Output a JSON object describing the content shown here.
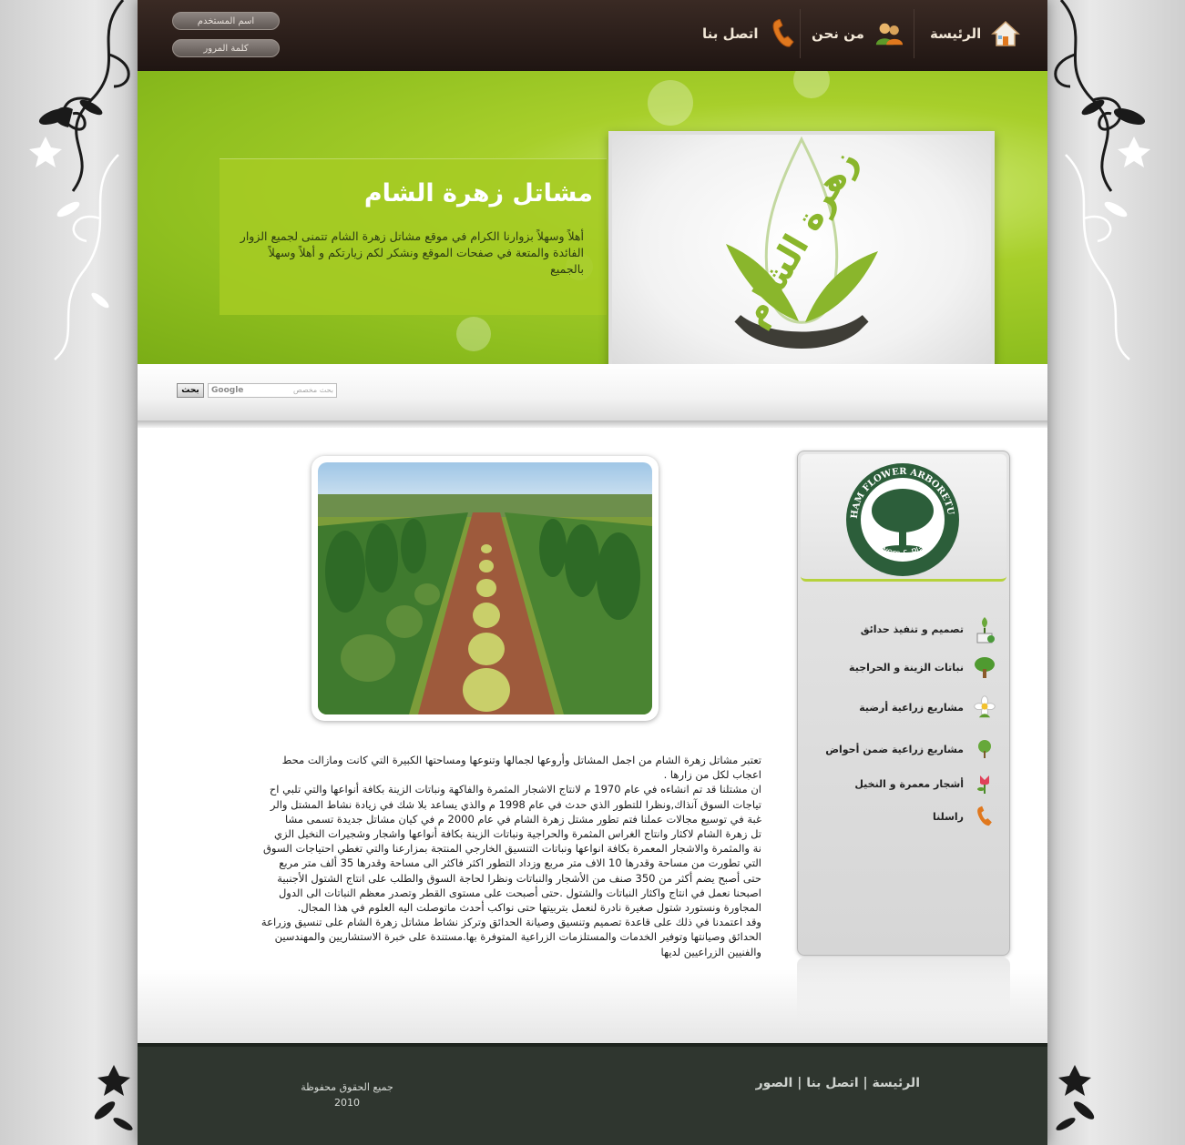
{
  "nav": {
    "home": "الرئيسة",
    "about": "من نحن",
    "contact": "اتصل بنا"
  },
  "login": {
    "username": "اسم المستخدم",
    "password": "كلمة المرور"
  },
  "banner": {
    "title": "مشاتل زهرة الشام",
    "text": "أهلاً وسهلاً بزوارنا الكرام في موقع مشاتل زهرة الشام تتمنى لجميع الزوار الفائدة والمتعة في صفحات الموقع ونشكر لكم زيارتكم و أهلاً وسهلاً بالجميع",
    "logo_text": "زهرة الشام"
  },
  "search": {
    "button": "بحث",
    "placeholder": "بحث مخصص",
    "brand": "Google"
  },
  "article": {
    "text": "تعتبر مشاتل زهرة الشام من اجمل المشاتل وأروعها لجمالها وتنوعها ومساحتها الكبيرة التي كانت ومازالت محط\nاعجاب لكل من زارها .\nان مشتلنا قد تم انشاءه في عام 1970 م لانتاج الاشجار المثمرة والفاكهة ونباتات الزينة بكافة أنواعها والتي تلبي اح\nتياجات السوق آنذاك,ونظرا للتطور الذي حدث في عام 1998 م والذي يساعد بلا شك في زيادة نشاط المشتل والر\nغبة في توسيع مجالات عملنا فتم تطور مشتل زهرة الشام في عام 2000 م في كيان مشاتل جديدة تسمى مشا\nتل زهرة الشام لاكثار وانتاج الغراس المثمرة والحراجية ونباتات الزينة بكافة أنواعها واشجار وشجيرات النخيل الزي\nنة والمثمرة والاشجار المعمرة بكافة انواعها ونباتات التنسيق الخارجي المنتجة بمزارعنا والتي تغطي احتياجات السوق\nالتي تطورت من مساحة وقدرها 10 الاف متر مربع وزداد التطور اكثر فاكثر الى مساحة وقدرها 35 ألف متر مربع\nحتى أصبح يضم أكثر من 350 صنف من الأشجار والنباتات ونظرا لحاجة السوق والطلب على انتاج الشتول الأجنبية\nاصبحنا نعمل في انتاج واكثار النباتات والشتول .حتى أصبحت على مستوى القطر وتصدر معظم النباتات الى الدول\nالمجاورة ونستورد شتول صغيرة نادرة لنعمل بتربيتها حتى نواكب أحدث ماتوصلت اليه العلوم في هذا المجال.\nوقد اعتمدنا في ذلك على قاعدة تصميم وتنسيق وصيانة الحدائق وتركز نشاط مشاتل زهرة الشام على تنسيق وزراعة\nالحدائق وصيانتها وتوفير الخدمات والمستلزمات الزراعية المتوفرة بها.مستندة على خبرة الاستشاريين والمهندسين\nوالفنيين الزراعيين لديها"
  },
  "sidebar": {
    "logo_text_top": "SHAM FLOWER ARBORETUM",
    "logo_text_bottom": "Flowers & Plants",
    "items": [
      {
        "label": "تصميم و تنفيذ حدائق",
        "icon": "plant-pot-icon"
      },
      {
        "label": "نباتات الزينة و الحراجية",
        "icon": "tree-icon"
      },
      {
        "label": "مشاريع زراعية أرضية",
        "icon": "daisy-icon"
      },
      {
        "label": "مشاريع زراعية ضمن أحواض",
        "icon": "small-tree-icon"
      },
      {
        "label": "أشجار معمرة و النخيل",
        "icon": "tulip-icon"
      },
      {
        "label": "راسلنا",
        "icon": "phone-icon"
      }
    ]
  },
  "footer": {
    "links": [
      "الرئيسة",
      "اتصل بنا",
      "الصور"
    ],
    "separator": "|",
    "copyright_line1": "جميع الحقوق محفوظة",
    "copyright_line2": "2010"
  },
  "colors": {
    "topbar": "#2a1d19",
    "banner_green": "#9cc62a",
    "footer": "#2f362f",
    "accent_orange": "#e0781e"
  }
}
